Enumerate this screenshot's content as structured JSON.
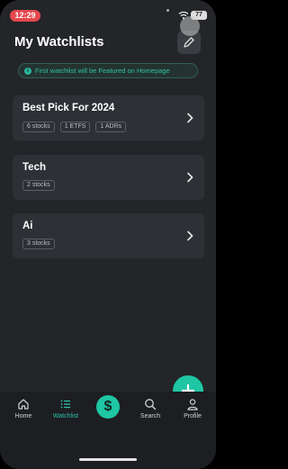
{
  "status_bar": {
    "time": "12:29",
    "battery": "77"
  },
  "header": {
    "title": "My Watchlists"
  },
  "banner": {
    "text": "First watchlist will be Featured on Homepage",
    "icon": "info-icon"
  },
  "watchlists": [
    {
      "name": "Best Pick For 2024",
      "tags": [
        "6 stocks",
        "1 ETFS",
        "1 ADRs"
      ]
    },
    {
      "name": "Tech",
      "tags": [
        "2 stocks"
      ]
    },
    {
      "name": "Ai",
      "tags": [
        "3 stocks"
      ]
    }
  ],
  "fab": {
    "icon": "plus-icon"
  },
  "nav": {
    "home": "Home",
    "watchlist": "Watchlist",
    "center_symbol": "$",
    "search": "Search",
    "profile": "Profile"
  },
  "colors": {
    "accent": "#1fc6a4",
    "background": "#232529",
    "card": "#2d3035",
    "time_pill": "#e5484d"
  }
}
